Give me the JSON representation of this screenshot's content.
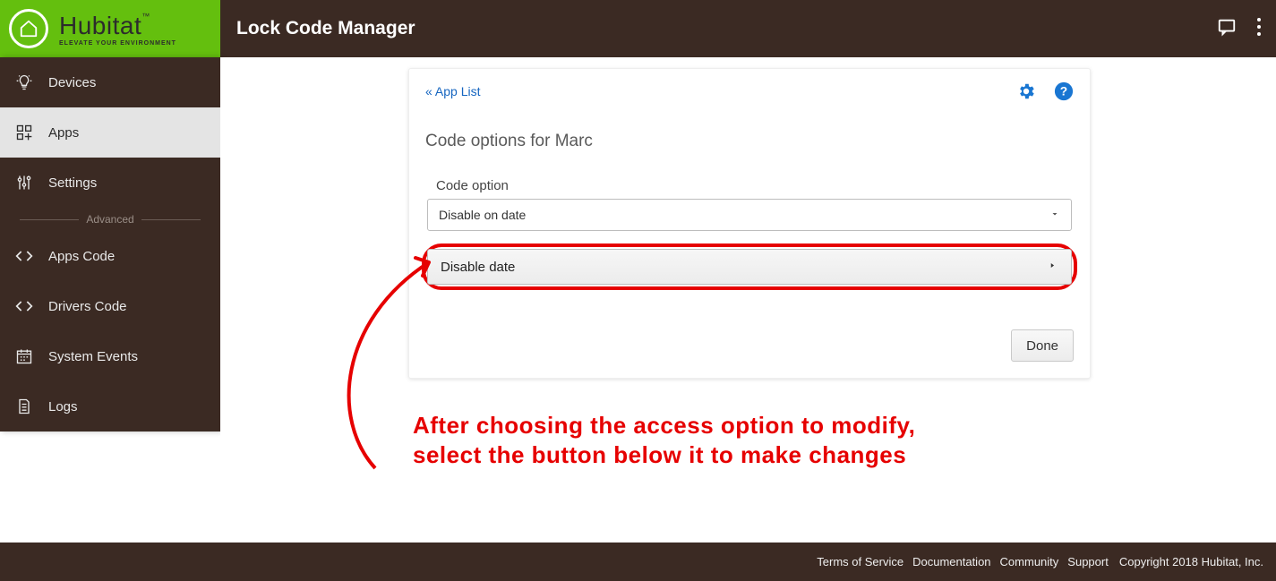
{
  "brand": {
    "name": "Hubitat",
    "tagline": "ELEVATE YOUR ENVIRONMENT",
    "tm": "™"
  },
  "header": {
    "title": "Lock Code Manager"
  },
  "sidebar": {
    "items": [
      {
        "label": "Devices"
      },
      {
        "label": "Apps"
      },
      {
        "label": "Settings"
      }
    ],
    "advanced_label": "Advanced",
    "advanced": [
      {
        "label": "Apps Code"
      },
      {
        "label": "Drivers Code"
      },
      {
        "label": "System Events"
      },
      {
        "label": "Logs"
      }
    ]
  },
  "card": {
    "back_link": "« App List",
    "title": "Code options for Marc",
    "field_label": "Code option",
    "select_value": "Disable on date",
    "action_label": "Disable date",
    "done_label": "Done"
  },
  "annotation": {
    "line1": "After choosing the access option to modify,",
    "line2": "select the button below it to make changes"
  },
  "footer": {
    "links": [
      "Terms of Service",
      "Documentation",
      "Community",
      "Support"
    ],
    "copyright": "Copyright 2018 Hubitat, Inc."
  }
}
